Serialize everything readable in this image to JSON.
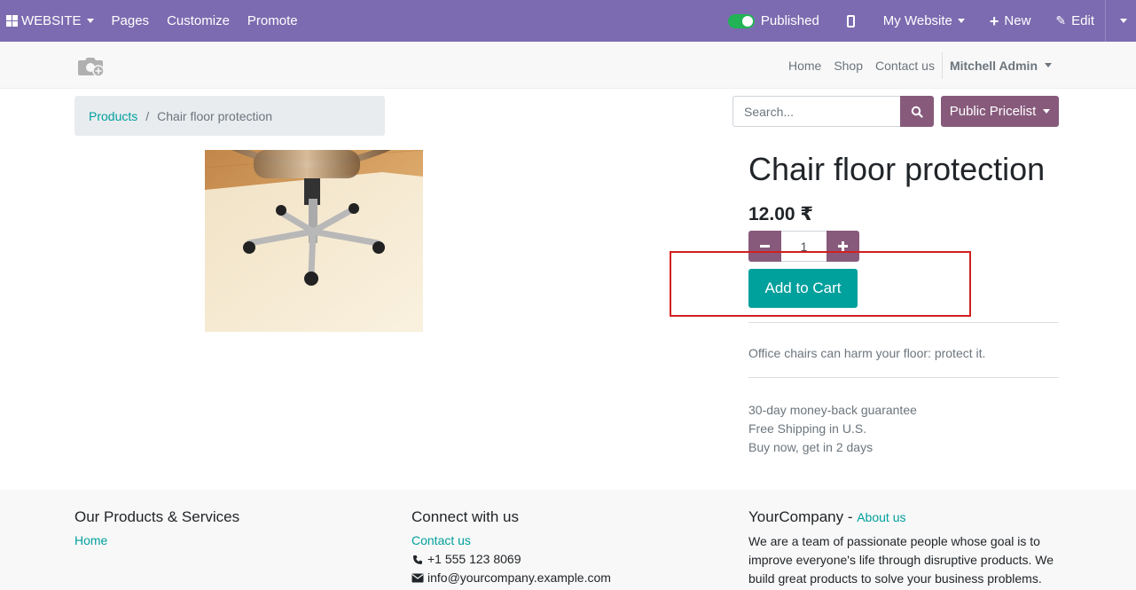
{
  "adminbar": {
    "website_label": "WEBSITE",
    "menu": [
      "Pages",
      "Customize",
      "Promote"
    ],
    "published_label": "Published",
    "my_website_label": "My Website",
    "new_label": "New",
    "edit_label": "Edit",
    "published_color": "#21b356"
  },
  "header": {
    "nav": [
      "Home",
      "Shop",
      "Contact us"
    ],
    "user": "Mitchell Admin"
  },
  "breadcrumb": {
    "parent": "Products",
    "separator": "/",
    "current": "Chair floor protection"
  },
  "search": {
    "placeholder": "Search..."
  },
  "pricelist": {
    "label": "Public Pricelist"
  },
  "product": {
    "name": "Chair floor protection",
    "price": "12.00 ₹",
    "quantity": "1",
    "add_to_cart": "Add to Cart",
    "description": "Office chairs can harm your floor: protect it.",
    "features": [
      "30-day money-back guarantee",
      "Free Shipping in U.S.",
      "Buy now, get in 2 days"
    ]
  },
  "footer": {
    "col1": {
      "title": "Our Products & Services",
      "link": "Home"
    },
    "col2": {
      "title": "Connect with us",
      "link": "Contact us",
      "phone": "+1 555 123 8069",
      "email": "info@yourcompany.example.com"
    },
    "col3": {
      "company": "YourCompany",
      "dash": " - ",
      "about": "About us",
      "text_lines": [
        "We are a team of passionate people whose goal is to",
        "improve everyone's life through disruptive products. We",
        "build great products to solve your business problems."
      ]
    }
  },
  "colors": {
    "adminbar": "#7c6bb0",
    "primary": "#875a7b",
    "accent": "#00a09d",
    "highlight": "#d21f1f"
  }
}
